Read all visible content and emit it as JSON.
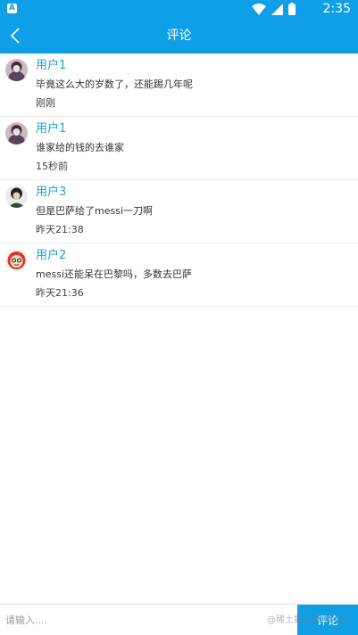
{
  "status": {
    "time": "2:35",
    "app_icon_letter": "A",
    "icons": [
      "wifi-icon",
      "signal-icon",
      "battery-icon"
    ]
  },
  "appbar": {
    "title": "评论"
  },
  "comments": [
    {
      "user": "用户1",
      "content": "毕竟这么大的岁数了，还能踢几年呢",
      "time": "刚刚"
    },
    {
      "user": "用户1",
      "content": "谁家给的钱的去谁家",
      "time": "15秒前"
    },
    {
      "user": "用户3",
      "content": "但是巴萨给了messi一刀啊",
      "time": "昨天21:38"
    },
    {
      "user": "用户2",
      "content": "messi还能呆在巴黎吗，多数去巴萨",
      "time": "昨天21:36"
    }
  ],
  "input": {
    "placeholder": "请输入....",
    "value": ""
  },
  "submit_label": "评论",
  "watermark": "@稀土掘金技术社区",
  "colors": {
    "primary": "#0f9fe6",
    "username": "#1a9fdd"
  }
}
